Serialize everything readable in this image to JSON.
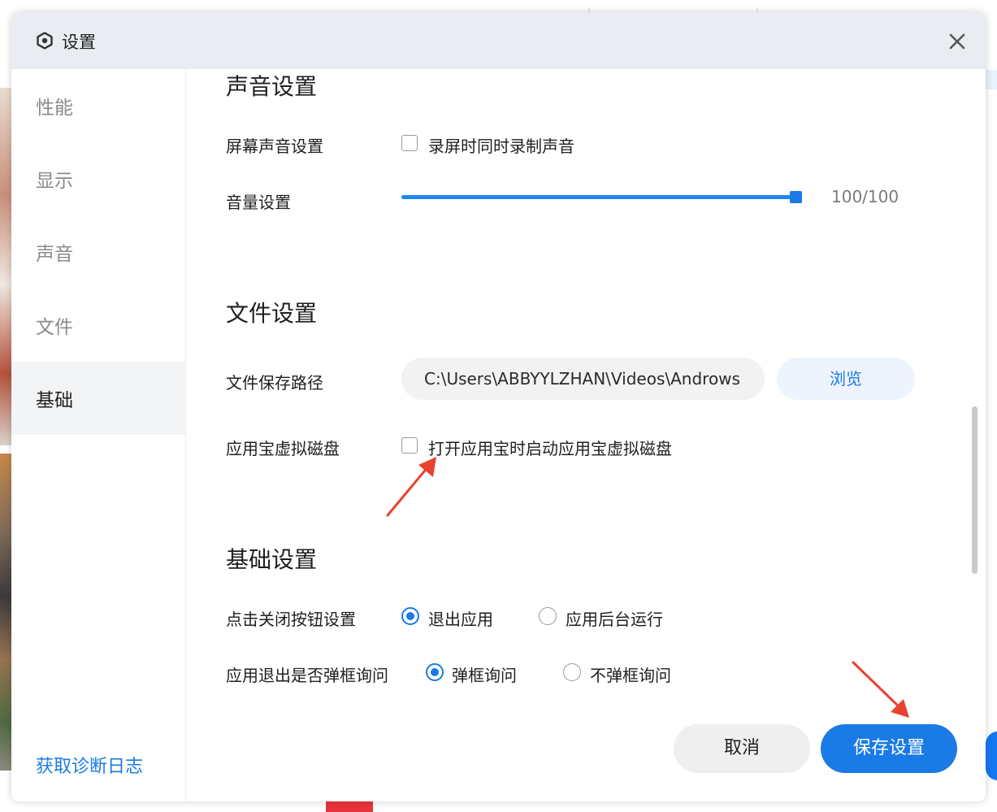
{
  "dialog": {
    "title": "设置",
    "title_icon": "settings-hexagon-icon",
    "close_icon": "close-icon"
  },
  "sidebar": {
    "items": [
      {
        "label": "性能",
        "active": false
      },
      {
        "label": "显示",
        "active": false
      },
      {
        "label": "声音",
        "active": false
      },
      {
        "label": "文件",
        "active": false
      },
      {
        "label": "基础",
        "active": true
      }
    ],
    "diagnostic_link": "获取诊断日志"
  },
  "sound": {
    "title": "声音设置",
    "screen_audio_label": "屏幕声音设置",
    "record_audio_option": "录屏时同时录制声音",
    "record_audio_checked": false,
    "volume_label": "音量设置",
    "volume_value_text": "100/100",
    "volume_level": 1.0
  },
  "file": {
    "title": "文件设置",
    "save_path_label": "文件保存路径",
    "save_path_value": "C:\\Users\\ABBYYLZHAN\\Videos\\Androws",
    "browse_label": "浏览",
    "virtual_disk_label": "应用宝虚拟磁盘",
    "virtual_disk_option": "打开应用宝时启动应用宝虚拟磁盘",
    "virtual_disk_checked": false
  },
  "basic": {
    "title": "基础设置",
    "close_button_label": "点击关闭按钮设置",
    "close_options": [
      {
        "label": "退出应用",
        "selected": true
      },
      {
        "label": "应用后台运行",
        "selected": false
      }
    ],
    "exit_prompt_label": "应用退出是否弹框询问",
    "exit_prompt_options": [
      {
        "label": "弹框询问",
        "selected": true
      },
      {
        "label": "不弹框询问",
        "selected": false
      }
    ]
  },
  "footer": {
    "cancel_label": "取消",
    "save_label": "保存设置"
  },
  "colors": {
    "accent": "#1a7ae6",
    "annotation_arrow": "#e8432e",
    "titlebar_bg": "#e9ecf1"
  }
}
